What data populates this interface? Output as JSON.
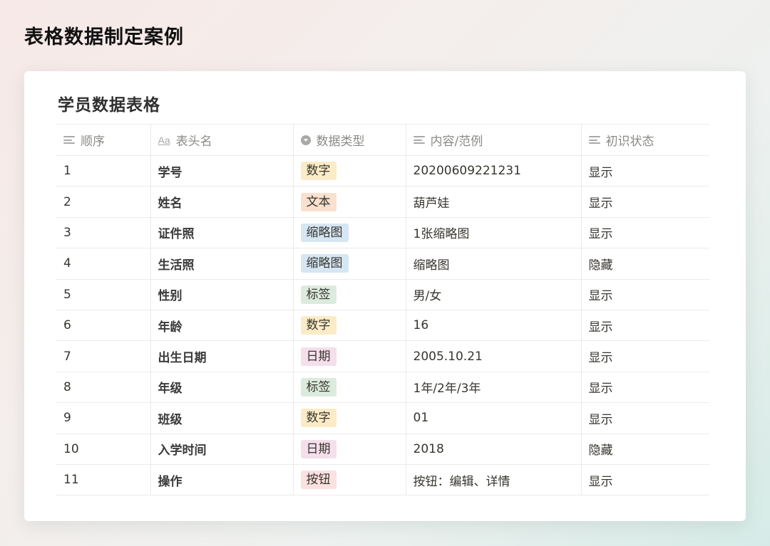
{
  "page_title": "表格数据制定案例",
  "table_title": "学员数据表格",
  "headers": [
    {
      "label": "顺序",
      "icon": "text-lines-icon"
    },
    {
      "label": "表头名",
      "icon": "text-aa-icon"
    },
    {
      "label": "数据类型",
      "icon": "select-icon"
    },
    {
      "label": "内容/范例",
      "icon": "text-lines-icon"
    },
    {
      "label": "初识状态",
      "icon": "text-lines-icon"
    }
  ],
  "tag_colors": {
    "数字": "#fbecc7",
    "文本": "#fae0cf",
    "缩略图": "#d6e6f2",
    "标签": "#dcebdd",
    "日期": "#f4dfeb",
    "按钮": "#fbe1df"
  },
  "rows": [
    {
      "order": "1",
      "name": "学号",
      "type": "数字",
      "example": "20200609221231",
      "status": "显示"
    },
    {
      "order": "2",
      "name": "姓名",
      "type": "文本",
      "example": "葫芦娃",
      "status": "显示"
    },
    {
      "order": "3",
      "name": "证件照",
      "type": "缩略图",
      "example": "1张缩略图",
      "status": "显示"
    },
    {
      "order": "4",
      "name": "生活照",
      "type": "缩略图",
      "example": "缩略图",
      "status": "隐藏"
    },
    {
      "order": "5",
      "name": "性别",
      "type": "标签",
      "example": "男/女",
      "status": "显示"
    },
    {
      "order": "6",
      "name": "年龄",
      "type": "数字",
      "example": "16",
      "status": "显示"
    },
    {
      "order": "7",
      "name": "出生日期",
      "type": "日期",
      "example": "2005.10.21",
      "status": "显示"
    },
    {
      "order": "8",
      "name": "年级",
      "type": "标签",
      "example": "1年/2年/3年",
      "status": "显示"
    },
    {
      "order": "9",
      "name": "班级",
      "type": "数字",
      "example": "01",
      "status": "显示"
    },
    {
      "order": "10",
      "name": "入学时间",
      "type": "日期",
      "example": "2018",
      "status": "隐藏"
    },
    {
      "order": "11",
      "name": "操作",
      "type": "按钮",
      "example": "按钮：编辑、详情",
      "status": "显示"
    }
  ]
}
